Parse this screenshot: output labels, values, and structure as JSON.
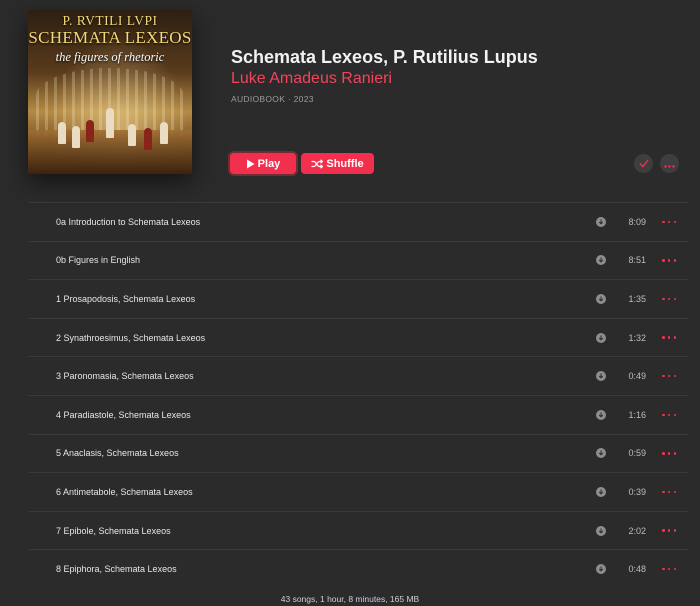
{
  "album": {
    "cover_lines": [
      "P. RVTILI LVPI",
      "SCHEMATA LEXEOS",
      "the figures of rhetoric"
    ],
    "title": "Schemata Lexeos, P. Rutilius Lupus",
    "artist": "Luke Amadeus Ranieri",
    "meta": "AUDIOBOOK · 2023"
  },
  "actions": {
    "play_label": "Play",
    "shuffle_label": "Shuffle",
    "added_icon": "checkmark-icon",
    "more_icon": "more-icon"
  },
  "colors": {
    "accent": "#f2304d",
    "background": "#2b2b2c"
  },
  "tracks": [
    {
      "title": "0a Introduction to Schemata Lexeos",
      "duration": "8:09"
    },
    {
      "title": "0b Figures in English",
      "duration": "8:51"
    },
    {
      "title": "1 Prosapodosis, Schemata Lexeos",
      "duration": "1:35"
    },
    {
      "title": "2 Synathroesimus, Schemata Lexeos",
      "duration": "1:32"
    },
    {
      "title": "3 Paronomasia, Schemata Lexeos",
      "duration": "0:49"
    },
    {
      "title": "4 Paradiastole, Schemata Lexeos",
      "duration": "1:16"
    },
    {
      "title": "5 Anaclasis, Schemata Lexeos",
      "duration": "0:59"
    },
    {
      "title": "6 Antimetabole, Schemata Lexeos",
      "duration": "0:39"
    },
    {
      "title": "7 Epibole, Schemata Lexeos",
      "duration": "2:02"
    },
    {
      "title": "8 Epiphora, Schemata Lexeos",
      "duration": "0:48"
    }
  ],
  "footer": "43 songs, 1 hour, 8 minutes, 165 MB"
}
